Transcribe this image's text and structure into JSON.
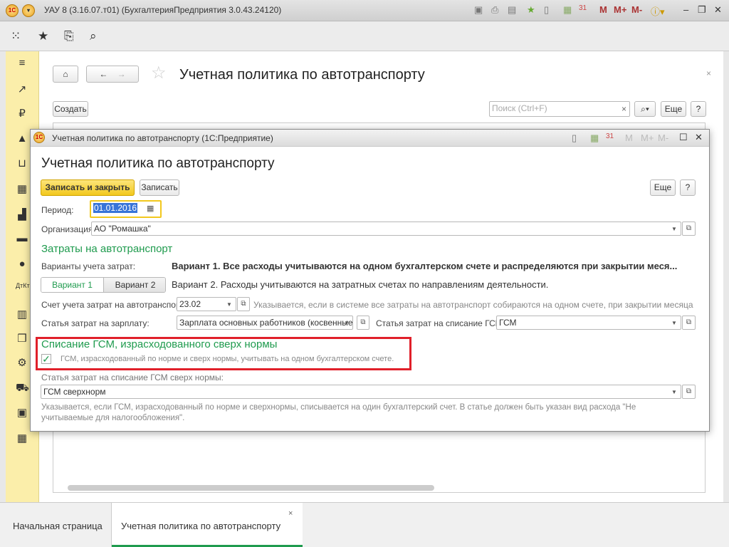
{
  "app": {
    "title": "УАУ 8 (3.16.07.т01) (БухгалтерияПредприятия 3.0.43.24120)",
    "m": "M",
    "mplus": "M+",
    "mminus": "M-"
  },
  "page": {
    "title": "Учетная политика по автотранспорту",
    "create_label": "Создать",
    "search_placeholder": "Поиск (Ctrl+F)",
    "more_label": "Еще",
    "help_label": "?"
  },
  "modal": {
    "window_title": "Учетная политика по автотранспорту  (1С:Предприятие)",
    "title": "Учетная политика по автотранспорту",
    "save_close_label": "Записать и закрыть",
    "save_label": "Записать",
    "more_label": "Еще",
    "help_label": "?",
    "period_label": "Период:",
    "period_value": "01.01.2016",
    "org_label": "Организация:",
    "org_value": "АО \"Ромашка\"",
    "section1": "Затраты на автотранспорт",
    "variants_label": "Варианты учета затрат:",
    "variant1_text": "Вариант 1. Все расходы учитываются на одном бухгалтерском счете и распределяются при закрытии меся...",
    "variant1_btn": "Вариант 1",
    "variant2_btn": "Вариант 2",
    "selected_variant": "Вариант 1",
    "variant2_text": "Вариант 2. Расходы учитываются на затратных счетах по направлениям деятельности.",
    "account_label": "Счет учета затрат на автотранспорт:",
    "account_value": "23.02",
    "account_hint": "Указывается, если в системе все затраты на автотранспорт собираются на одном счете, при закрытии месяца распр...",
    "salary_label": "Статья затрат на зарплату:",
    "salary_value": "Зарплата основных работников (косвенные",
    "fuel_label": "Статья затрат на списание ГСМ:",
    "fuel_value": "ГСМ",
    "section2": "Списание ГСМ, израсходованного сверх нормы",
    "checkbox_label": "ГСМ, израсходованный по норме и сверх нормы, учитывать на одном бухгалтерском счете.",
    "checkbox_checked": true,
    "over_label": "Статья затрат на списание ГСМ сверх нормы:",
    "over_value": "ГСМ сверхнорм",
    "over_hint": "Указывается, если ГСМ, израсходованный по норме и сверхнормы, списывается на один бухгалтерский счет. В статье должен быть указан вид расхода \"Не учитываемые для налогообложения\"."
  },
  "tabs": [
    {
      "label": "Начальная страница"
    },
    {
      "label": "Учетная политика по автотранспорту",
      "active": true
    }
  ],
  "colors": {
    "accent_green": "#1f9b4e",
    "highlight_red": "#e0202a",
    "primary_button": "#f5d233",
    "sidebar": "#fbeeaa"
  }
}
